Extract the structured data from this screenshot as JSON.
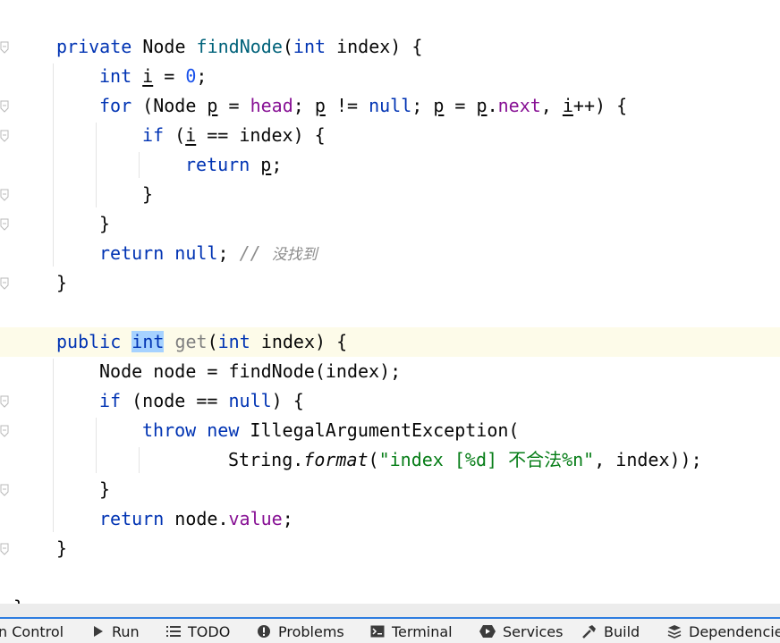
{
  "editor": {
    "lines": [
      {
        "indent": 1,
        "tokens": [
          {
            "t": "private ",
            "c": "kw"
          },
          {
            "t": "Node "
          },
          {
            "t": "findNode",
            "c": "fn"
          },
          {
            "t": "("
          },
          {
            "t": "int ",
            "c": "kw"
          },
          {
            "t": "index) {"
          }
        ]
      },
      {
        "indent": 2,
        "tokens": [
          {
            "t": "int ",
            "c": "kw"
          },
          {
            "t": "i",
            "c": "ul"
          },
          {
            "t": " = "
          },
          {
            "t": "0",
            "c": "num"
          },
          {
            "t": ";"
          }
        ]
      },
      {
        "indent": 2,
        "tokens": [
          {
            "t": "for ",
            "c": "kw"
          },
          {
            "t": "(Node "
          },
          {
            "t": "p",
            "c": "ul"
          },
          {
            "t": " = "
          },
          {
            "t": "head",
            "c": "fld"
          },
          {
            "t": "; "
          },
          {
            "t": "p",
            "c": "ul"
          },
          {
            "t": " != "
          },
          {
            "t": "null",
            "c": "kw"
          },
          {
            "t": "; "
          },
          {
            "t": "p",
            "c": "ul"
          },
          {
            "t": " = "
          },
          {
            "t": "p",
            "c": "ul"
          },
          {
            "t": "."
          },
          {
            "t": "next",
            "c": "fld"
          },
          {
            "t": ", "
          },
          {
            "t": "i",
            "c": "ul"
          },
          {
            "t": "++) {"
          }
        ]
      },
      {
        "indent": 3,
        "tokens": [
          {
            "t": "if ",
            "c": "kw"
          },
          {
            "t": "("
          },
          {
            "t": "i",
            "c": "ul"
          },
          {
            "t": " == index) {"
          }
        ]
      },
      {
        "indent": 4,
        "tokens": [
          {
            "t": "return ",
            "c": "kw"
          },
          {
            "t": "p",
            "c": "ul"
          },
          {
            "t": ";"
          }
        ]
      },
      {
        "indent": 3,
        "tokens": [
          {
            "t": "}"
          }
        ]
      },
      {
        "indent": 2,
        "tokens": [
          {
            "t": "}"
          }
        ]
      },
      {
        "indent": 2,
        "tokens": [
          {
            "t": "return ",
            "c": "kw"
          },
          {
            "t": "null",
            "c": "kw"
          },
          {
            "t": "; "
          },
          {
            "t": "// ",
            "c": "cmt"
          },
          {
            "t": "没找到",
            "c": "cmt-zh"
          }
        ]
      },
      {
        "indent": 1,
        "tokens": [
          {
            "t": "}"
          }
        ]
      },
      {
        "indent": 0,
        "tokens": []
      },
      {
        "indent": 1,
        "current": true,
        "tokens": [
          {
            "t": "public ",
            "c": "kw"
          },
          {
            "t": "int",
            "c": "kw hl"
          },
          {
            "t": " "
          },
          {
            "t": "get",
            "c": "fn-unused"
          },
          {
            "t": "("
          },
          {
            "t": "int ",
            "c": "kw"
          },
          {
            "t": "index) {"
          }
        ]
      },
      {
        "indent": 2,
        "tokens": [
          {
            "t": "Node node = findNode(index);"
          }
        ]
      },
      {
        "indent": 2,
        "tokens": [
          {
            "t": "if ",
            "c": "kw"
          },
          {
            "t": "(node == "
          },
          {
            "t": "null",
            "c": "kw"
          },
          {
            "t": ") {"
          }
        ]
      },
      {
        "indent": 3,
        "tokens": [
          {
            "t": "throw ",
            "c": "kw"
          },
          {
            "t": "new ",
            "c": "kw"
          },
          {
            "t": "IllegalArgumentException("
          }
        ]
      },
      {
        "indent": 5,
        "tokens": [
          {
            "t": "String."
          },
          {
            "t": "format",
            "c": "ital"
          },
          {
            "t": "("
          },
          {
            "t": "\"index [%d] 不合法%n\"",
            "c": "str"
          },
          {
            "t": ", index));"
          }
        ]
      },
      {
        "indent": 2,
        "tokens": [
          {
            "t": "}"
          }
        ]
      },
      {
        "indent": 2,
        "tokens": [
          {
            "t": "return ",
            "c": "kw"
          },
          {
            "t": "node."
          },
          {
            "t": "value",
            "c": "fld"
          },
          {
            "t": ";"
          }
        ]
      },
      {
        "indent": 1,
        "tokens": [
          {
            "t": "}"
          }
        ]
      },
      {
        "indent": 0,
        "tokens": []
      },
      {
        "indent": 0,
        "tokens": [
          {
            "t": "}"
          }
        ]
      }
    ]
  },
  "toolbar": {
    "items": [
      {
        "label": "n Control",
        "icon": "version-control-icon"
      },
      {
        "label": "Run",
        "icon": "run-icon"
      },
      {
        "label": "TODO",
        "icon": "todo-icon"
      },
      {
        "label": "Problems",
        "icon": "problems-icon"
      },
      {
        "label": "Terminal",
        "icon": "terminal-icon"
      },
      {
        "label": "Services",
        "icon": "services-icon"
      },
      {
        "label": "Build",
        "icon": "build-icon"
      },
      {
        "label": "Dependencies",
        "icon": "dependencies-icon"
      }
    ]
  },
  "colors": {
    "keyword": "#0033b3",
    "field": "#871094",
    "string": "#067d17",
    "number": "#1750eb",
    "selection": "#a6d2ff",
    "current_line": "#fdfbe9",
    "status_accent": "#2d7de0"
  }
}
